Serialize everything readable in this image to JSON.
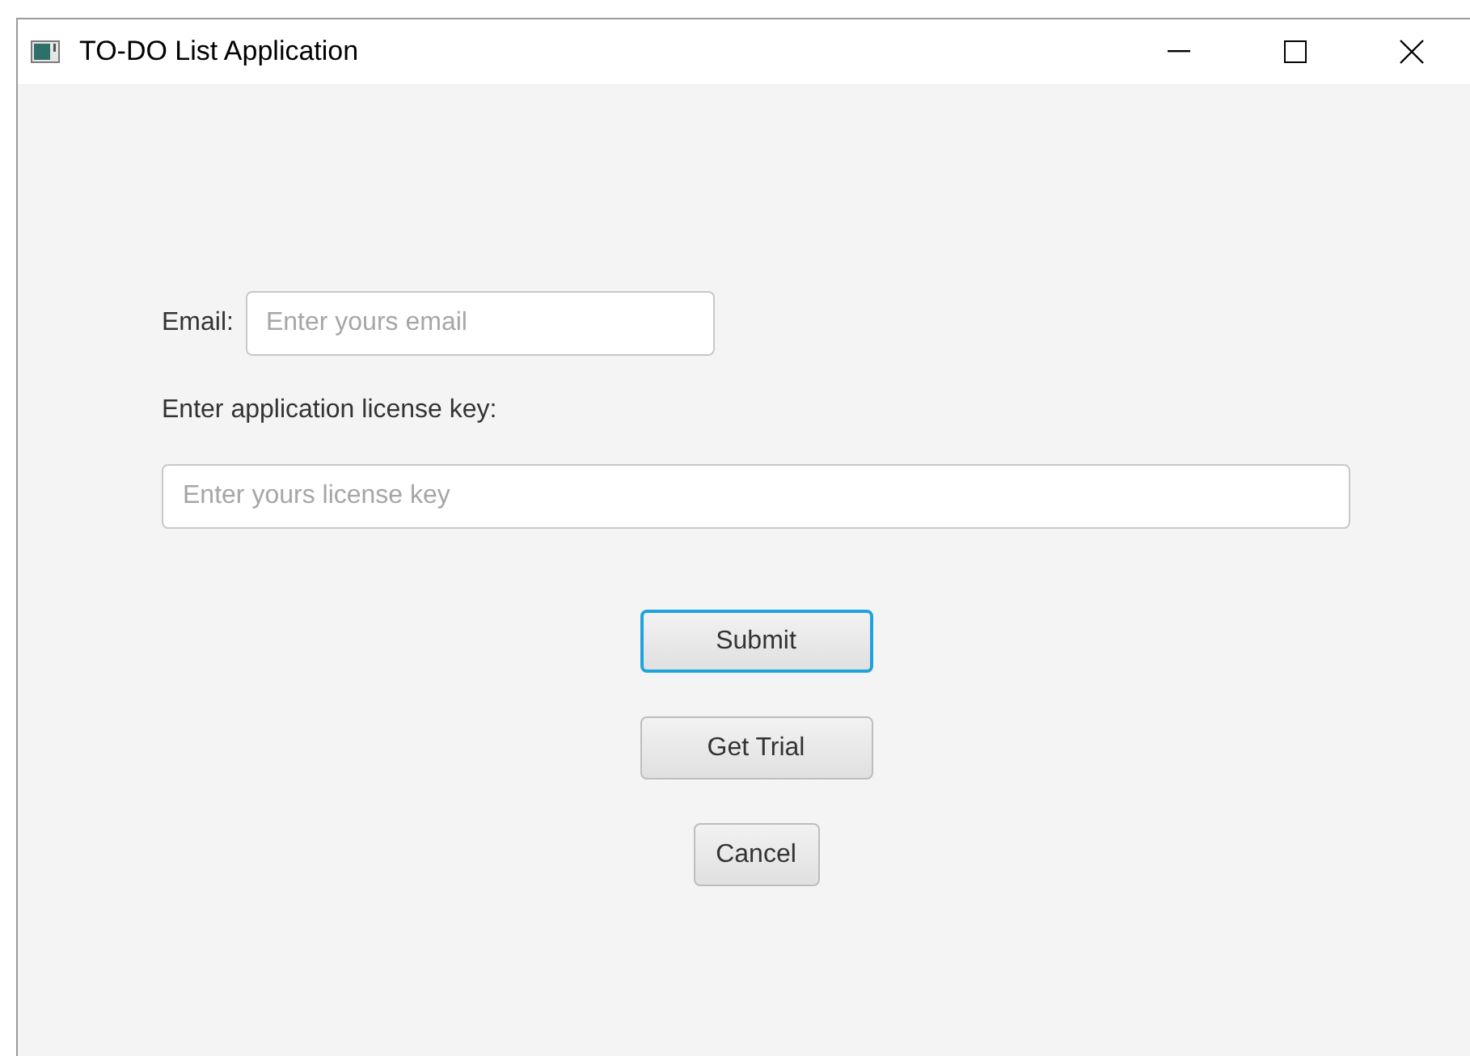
{
  "window": {
    "title": "TO-DO List Application"
  },
  "email": {
    "label": "Email:",
    "placeholder": "Enter yours email"
  },
  "license": {
    "label": "Enter application license key:",
    "placeholder": "Enter yours license key"
  },
  "buttons": [
    {
      "label": "Submit",
      "focused": true
    },
    {
      "label": "Get Trial",
      "focused": false
    },
    {
      "label": "Cancel",
      "focused": false
    }
  ]
}
